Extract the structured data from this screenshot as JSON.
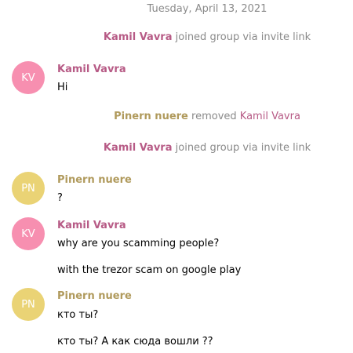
{
  "date": "Tuesday, April 13, 2021",
  "colors": {
    "kamil": "#b75b86",
    "pinern": "#b09a5c",
    "kamil_avatar": "#f78fb0",
    "pinern_avatar": "#ead375",
    "service_text": "#8a8a8a"
  },
  "events": [
    {
      "type": "service",
      "actor": "Kamil Vavra",
      "action": "joined group via invite link"
    },
    {
      "type": "message",
      "initials": "KV",
      "author": "Kamil Vavra",
      "lines": [
        "Hi"
      ]
    },
    {
      "type": "service",
      "actor": "Pinern nuere",
      "action": "removed",
      "target": "Kamil Vavra"
    },
    {
      "type": "service",
      "actor": "Kamil Vavra",
      "action": "joined group via invite link"
    },
    {
      "type": "message",
      "initials": "PN",
      "author": "Pinern nuere",
      "lines": [
        "?"
      ]
    },
    {
      "type": "message",
      "initials": "KV",
      "author": "Kamil Vavra",
      "lines": [
        "why are you scamming people?",
        "with the trezor scam on google play"
      ]
    },
    {
      "type": "message",
      "initials": "PN",
      "author": "Pinern nuere",
      "lines": [
        "кто ты?",
        "кто ты? А как сюда вошли ??"
      ]
    }
  ]
}
